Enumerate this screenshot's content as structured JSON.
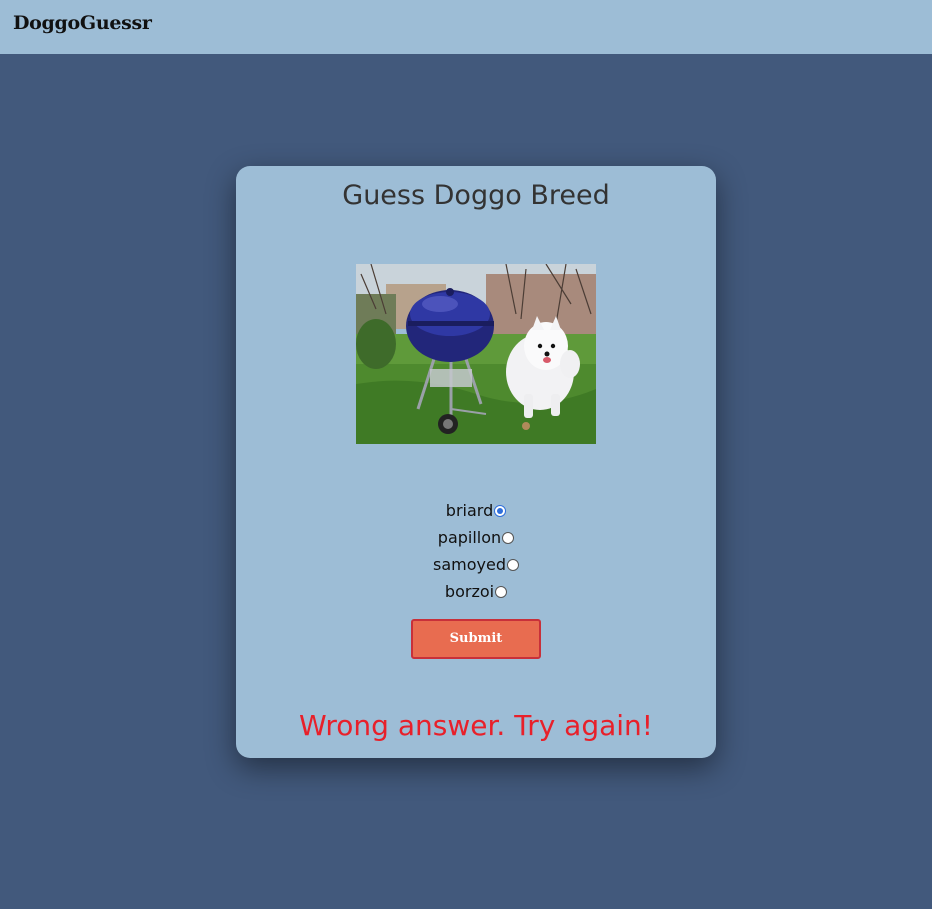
{
  "navbar": {
    "brand": "DoggoGuessr"
  },
  "quiz": {
    "title": "Guess Doggo Breed",
    "image_subject": "white samoyed dog next to a blue kettle grill on a lawn",
    "options": [
      {
        "label": "briard",
        "checked": true
      },
      {
        "label": "papillon",
        "checked": false
      },
      {
        "label": "samoyed",
        "checked": false
      },
      {
        "label": "borzoi",
        "checked": false
      }
    ],
    "submit_label": "Submit",
    "result_message": "Wrong answer. Try again!"
  },
  "colors": {
    "page_background": "#42597c",
    "navbar_background": "#9dbdd6",
    "card_background": "#9dbdd6",
    "submit_background": "#e86c50",
    "submit_border": "#c8303a",
    "error_text": "#e8202a"
  }
}
